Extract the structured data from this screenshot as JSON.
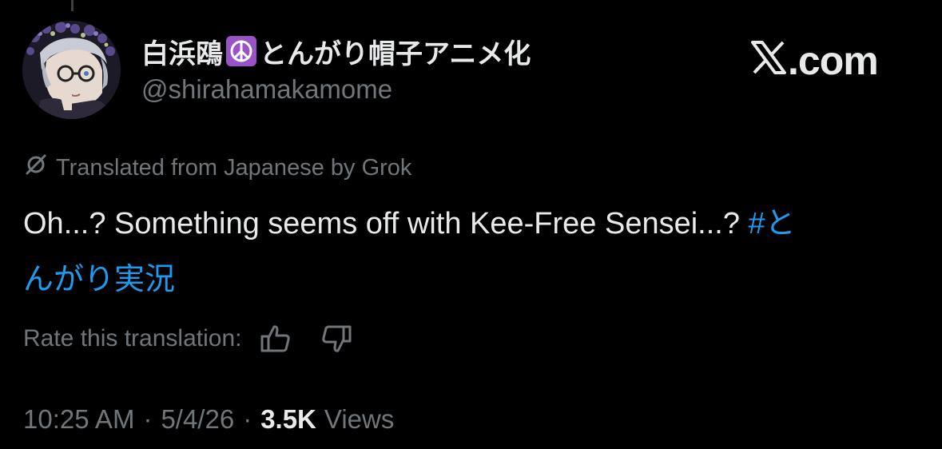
{
  "author": {
    "display_name_prefix": "白浜鴎",
    "display_name_emoji": "peace-symbol-icon",
    "display_name_suffix": "とんがり帽子アニメ化",
    "handle": "@shirahamakamome",
    "avatar": "avatar-image"
  },
  "brand": {
    "logo_icon": "x-logo-icon",
    "text": ".com"
  },
  "translation": {
    "icon": "grok-icon",
    "label": "Translated from Japanese by Grok",
    "rate_label": "Rate this translation:",
    "thumb_up_icon": "thumbs-up-icon",
    "thumb_down_icon": "thumbs-down-icon"
  },
  "post": {
    "text": "Oh...? Something seems off with Kee-Free Sensei...?",
    "hashtag": "#とんがり実況",
    "hashtag_color": "#1d9bf0"
  },
  "meta": {
    "time": "10:25 AM",
    "separator": "·",
    "date": "5/4/26",
    "views_count": "3.5K",
    "views_label": "Views"
  },
  "colors": {
    "background": "#000000",
    "primary_text": "#e7e9ea",
    "secondary_text": "#71767b",
    "peace_bg": "#9a52c8"
  }
}
